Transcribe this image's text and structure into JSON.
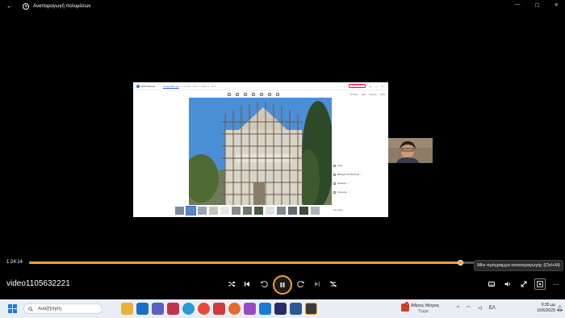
{
  "window": {
    "title": "Αναπαραγωγή πολυμέσων",
    "controls": {
      "minimize": "—",
      "maximize": "▢",
      "close": "✕"
    }
  },
  "embedded_screen": {
    "app_name": "WPS Photos",
    "file_name": "image0001.jpg",
    "meta": "2.11 MB · 1872 × 2499 px · 57%",
    "upgrade_label": "Upgrade Now",
    "actions": [
      "AI Tools",
      "Edit",
      "Convert",
      "Print"
    ],
    "side_options": [
      {
        "label": "Crop"
      },
      {
        "label": "Background Removal"
      },
      {
        "label": "Enhance"
      },
      {
        "label": "Colourise"
      }
    ],
    "image_count": "30 images"
  },
  "player": {
    "current_time": "1:24:14",
    "progress_fraction": 0.87,
    "tooltip": "Μίνι πρόγραμμα αναπαραγωγής (Ctrl+M)",
    "video_name": "video1105632221",
    "accent_color": "#f2a23a"
  },
  "taskbar": {
    "search_placeholder": "Αναζήτηση",
    "weather_temp": "Αίθριος Μέτριος",
    "weather_sub": "Τώρα",
    "language": "ΕΛ",
    "time": "9:35 μμ",
    "date": "16/6/2025",
    "weather_badge": "1"
  }
}
